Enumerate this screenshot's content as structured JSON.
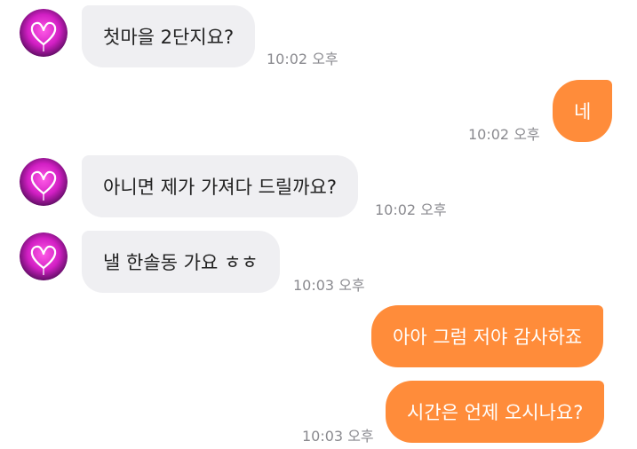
{
  "colors": {
    "incoming_bubble": "#efeff2",
    "outgoing_bubble": "#ff8c3a",
    "avatar_accent": "#ff2bd6",
    "timestamp": "#8a8a8f"
  },
  "avatar_icon": "neon-heart-icon",
  "messages": [
    {
      "sender": "other",
      "text": "첫마을 2단지요?",
      "time": "10:02 오후"
    },
    {
      "sender": "me",
      "text": "네",
      "time": "10:02 오후"
    },
    {
      "sender": "other",
      "text": "아니면 제가 가져다 드릴까요?",
      "time": "10:02 오후"
    },
    {
      "sender": "other",
      "text": "낼 한솔동 가요 ㅎㅎ",
      "time": "10:03 오후"
    },
    {
      "sender": "me",
      "text": "아아 그럼 저야 감사하죠",
      "time": ""
    },
    {
      "sender": "me",
      "text": "시간은 언제 오시나요?",
      "time": "10:03 오후"
    }
  ]
}
